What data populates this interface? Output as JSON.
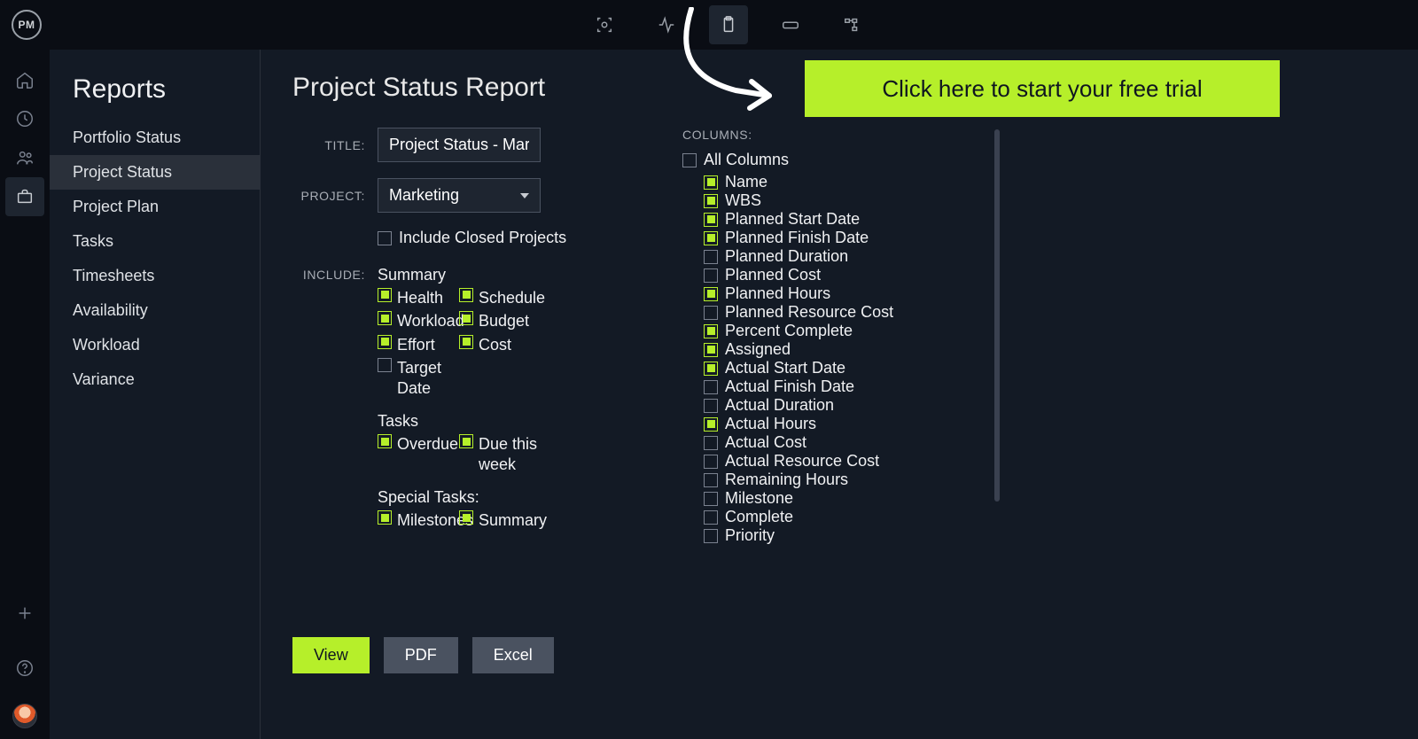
{
  "logo": "PM",
  "topIcons": [
    "scan-icon",
    "activity-icon",
    "clipboard-icon",
    "credit-card-icon",
    "flow-icon"
  ],
  "topActiveIndex": 2,
  "rail": {
    "items": [
      "home-icon",
      "clock-icon",
      "people-icon",
      "briefcase-icon"
    ],
    "activeIndex": 3,
    "add": "plus-icon",
    "help": "help-icon"
  },
  "sidebar": {
    "title": "Reports",
    "items": [
      "Portfolio Status",
      "Project Status",
      "Project Plan",
      "Tasks",
      "Timesheets",
      "Availability",
      "Workload",
      "Variance"
    ],
    "activeIndex": 1
  },
  "page": {
    "title": "Project Status Report",
    "titleLabel": "TITLE:",
    "titleValue": "Project Status - Mark",
    "projectLabel": "PROJECT:",
    "projectValue": "Marketing",
    "includeClosed": {
      "label": "Include Closed Projects",
      "checked": false
    },
    "includeLabel": "INCLUDE:",
    "summary": {
      "heading": "Summary",
      "items": [
        {
          "label": "Health",
          "checked": true
        },
        {
          "label": "Schedule",
          "checked": true
        },
        {
          "label": "Workload",
          "checked": true
        },
        {
          "label": "Budget",
          "checked": true
        },
        {
          "label": "Effort",
          "checked": true
        },
        {
          "label": "Cost",
          "checked": true
        },
        {
          "label": "Target Date",
          "checked": false
        }
      ]
    },
    "tasks": {
      "heading": "Tasks",
      "items": [
        {
          "label": "Overdue",
          "checked": true
        },
        {
          "label": "Due this week",
          "checked": true
        }
      ]
    },
    "special": {
      "heading": "Special Tasks:",
      "items": [
        {
          "label": "Milestones",
          "checked": true
        },
        {
          "label": "Summary",
          "checked": true
        }
      ]
    },
    "columnsLabel": "COLUMNS:",
    "allColumns": {
      "label": "All Columns",
      "checked": false
    },
    "columns": [
      {
        "label": "Name",
        "checked": true
      },
      {
        "label": "WBS",
        "checked": true
      },
      {
        "label": "Planned Start Date",
        "checked": true
      },
      {
        "label": "Planned Finish Date",
        "checked": true
      },
      {
        "label": "Planned Duration",
        "checked": false
      },
      {
        "label": "Planned Cost",
        "checked": false
      },
      {
        "label": "Planned Hours",
        "checked": true
      },
      {
        "label": "Planned Resource Cost",
        "checked": false
      },
      {
        "label": "Percent Complete",
        "checked": true
      },
      {
        "label": "Assigned",
        "checked": true
      },
      {
        "label": "Actual Start Date",
        "checked": true
      },
      {
        "label": "Actual Finish Date",
        "checked": false
      },
      {
        "label": "Actual Duration",
        "checked": false
      },
      {
        "label": "Actual Hours",
        "checked": true
      },
      {
        "label": "Actual Cost",
        "checked": false
      },
      {
        "label": "Actual Resource Cost",
        "checked": false
      },
      {
        "label": "Remaining Hours",
        "checked": false
      },
      {
        "label": "Milestone",
        "checked": false
      },
      {
        "label": "Complete",
        "checked": false
      },
      {
        "label": "Priority",
        "checked": false
      }
    ],
    "buttons": {
      "view": "View",
      "pdf": "PDF",
      "excel": "Excel"
    }
  },
  "cta": "Click here to start your free trial"
}
